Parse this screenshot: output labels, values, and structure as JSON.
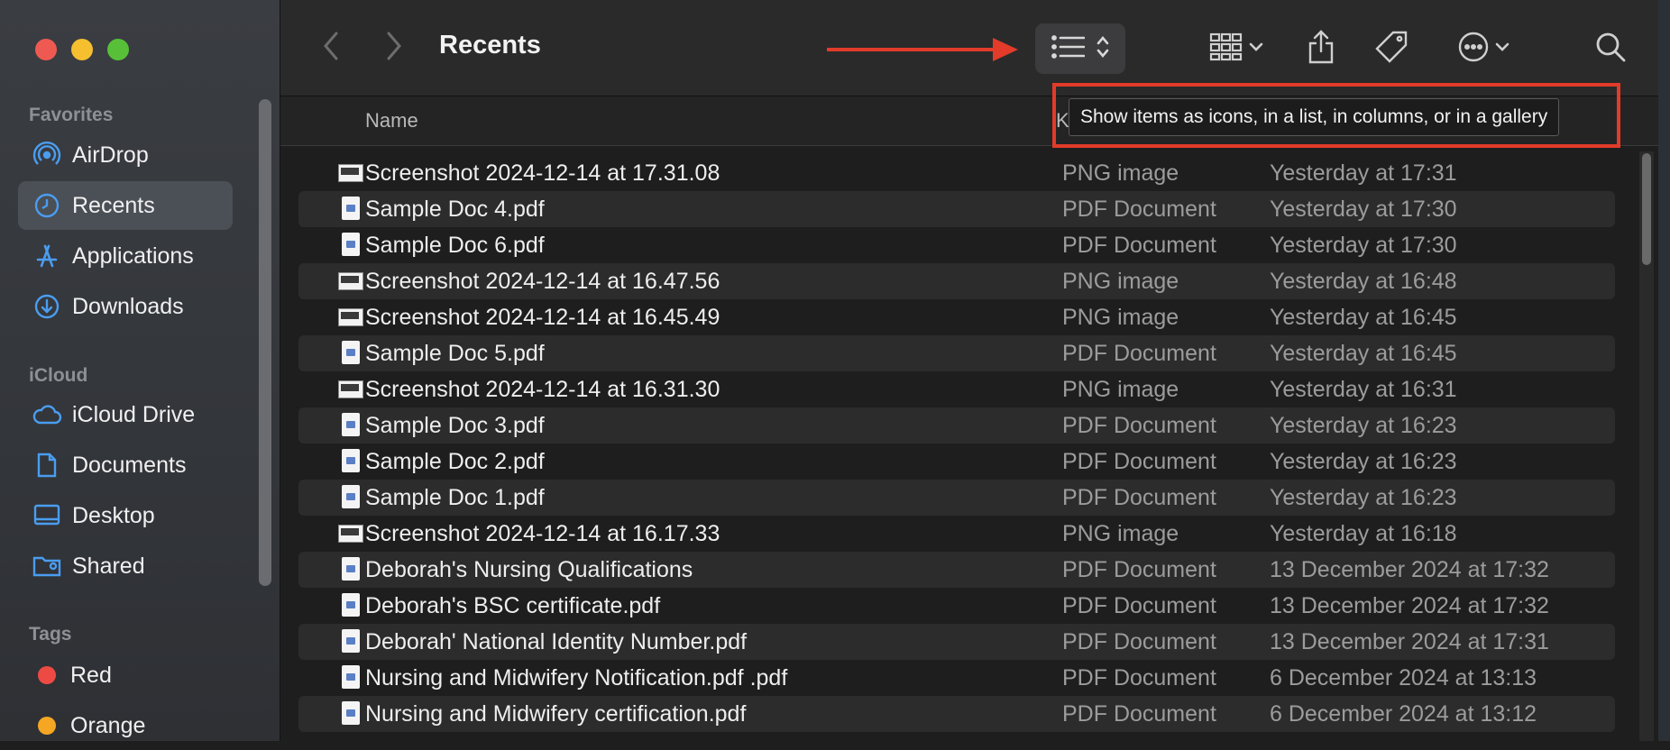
{
  "window": {
    "title": "Recents"
  },
  "sidebar": {
    "sections": {
      "favorites": "Favorites",
      "icloud": "iCloud",
      "tags": "Tags"
    },
    "favorites": [
      {
        "label": "AirDrop",
        "icon": "airdrop-icon"
      },
      {
        "label": "Recents",
        "icon": "clock-icon",
        "selected": true
      },
      {
        "label": "Applications",
        "icon": "applications-icon"
      },
      {
        "label": "Downloads",
        "icon": "download-icon"
      }
    ],
    "icloud": [
      {
        "label": "iCloud Drive",
        "icon": "cloud-icon"
      },
      {
        "label": "Documents",
        "icon": "document-icon"
      },
      {
        "label": "Desktop",
        "icon": "desktop-icon"
      },
      {
        "label": "Shared",
        "icon": "shared-folder-icon"
      }
    ],
    "tags": [
      {
        "label": "Red",
        "color": "#ee4a44"
      },
      {
        "label": "Orange",
        "color": "#f5a623"
      }
    ]
  },
  "columns": {
    "name": "Name",
    "kind": "K"
  },
  "tooltip": "Show items as icons, in a list, in columns, or in a gallery",
  "files": [
    {
      "name": "Screenshot 2024-12-14 at 17.31.08",
      "kind": "PNG image",
      "date": "Yesterday at 17:31",
      "type": "png"
    },
    {
      "name": "Sample Doc 4.pdf",
      "kind": "PDF Document",
      "date": "Yesterday at 17:30",
      "type": "pdf"
    },
    {
      "name": "Sample Doc 6.pdf",
      "kind": "PDF Document",
      "date": "Yesterday at 17:30",
      "type": "pdf"
    },
    {
      "name": "Screenshot 2024-12-14 at 16.47.56",
      "kind": "PNG image",
      "date": "Yesterday at 16:48",
      "type": "png"
    },
    {
      "name": "Screenshot 2024-12-14 at 16.45.49",
      "kind": "PNG image",
      "date": "Yesterday at 16:45",
      "type": "png"
    },
    {
      "name": "Sample Doc 5.pdf",
      "kind": "PDF Document",
      "date": "Yesterday at 16:45",
      "type": "pdf"
    },
    {
      "name": "Screenshot 2024-12-14 at 16.31.30",
      "kind": "PNG image",
      "date": "Yesterday at 16:31",
      "type": "png"
    },
    {
      "name": "Sample Doc 3.pdf",
      "kind": "PDF Document",
      "date": "Yesterday at 16:23",
      "type": "pdf"
    },
    {
      "name": "Sample Doc 2.pdf",
      "kind": "PDF Document",
      "date": "Yesterday at 16:23",
      "type": "pdf"
    },
    {
      "name": "Sample Doc 1.pdf",
      "kind": "PDF Document",
      "date": "Yesterday at 16:23",
      "type": "pdf"
    },
    {
      "name": "Screenshot 2024-12-14 at 16.17.33",
      "kind": "PNG image",
      "date": "Yesterday at 16:18",
      "type": "png"
    },
    {
      "name": "Deborah's Nursing Qualifications",
      "kind": "PDF Document",
      "date": "13 December 2024 at 17:32",
      "type": "pdf"
    },
    {
      "name": "Deborah's BSC certificate.pdf",
      "kind": "PDF Document",
      "date": "13 December 2024 at 17:32",
      "type": "pdf"
    },
    {
      "name": "Deborah' National Identity Number.pdf",
      "kind": "PDF Document",
      "date": "13 December 2024 at 17:31",
      "type": "pdf"
    },
    {
      "name": "Nursing and Midwifery Notification.pdf .pdf",
      "kind": "PDF Document",
      "date": "6 December 2024 at 13:13",
      "type": "pdf"
    },
    {
      "name": "Nursing and Midwifery certification.pdf",
      "kind": "PDF Document",
      "date": "6 December 2024 at 13:12",
      "type": "pdf"
    }
  ],
  "colors": {
    "annotation": "#e23b2a",
    "accent": "#4a9df0"
  }
}
